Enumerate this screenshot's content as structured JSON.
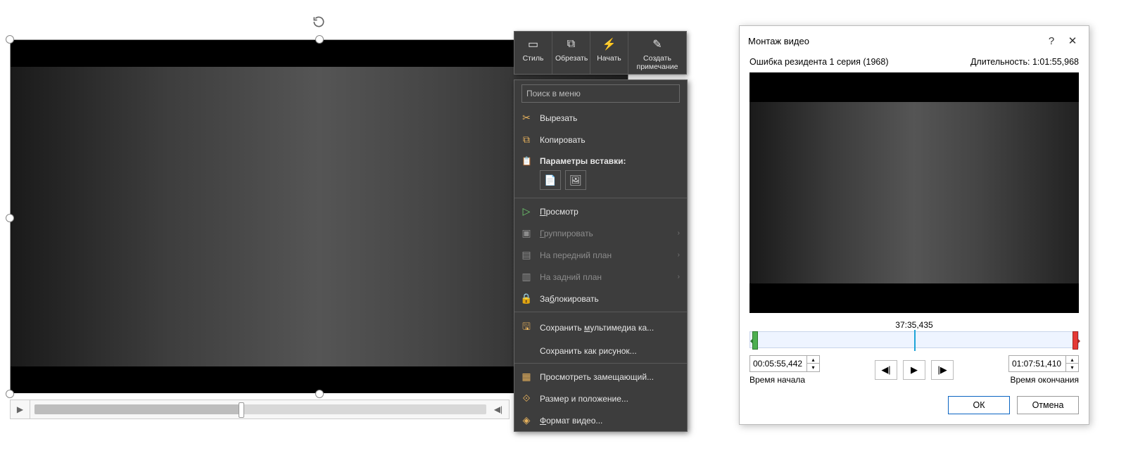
{
  "mini_toolbar": {
    "style": "Стиль",
    "crop": "Обрезать",
    "start": "Начать",
    "note": "Создать примечание"
  },
  "context_menu": {
    "search_placeholder": "Поиск в меню",
    "cut": "Вырезать",
    "copy": "Копировать",
    "paste_heading": "Параметры вставки:",
    "preview": "Просмотр",
    "group": "Группировать",
    "bring_front": "На передний план",
    "send_back": "На задний план",
    "lock": "Заблокировать",
    "save_media": "Сохранить мультимедиа ка...",
    "save_picture": "Сохранить как рисунок...",
    "view_placeholder": "Просмотреть замещающий...",
    "size_position": "Размер и положение...",
    "format_video": "Формат видео..."
  },
  "dialog": {
    "title": "Монтаж видео",
    "video_name": "Ошибка резидента 1 серия (1968)",
    "duration_label": "Длительность:",
    "duration_value": "1:01:55,968",
    "current_time": "37:35,435",
    "start_time": "00:05:55,442",
    "start_label": "Время начала",
    "end_time": "01:07:51,410",
    "end_label": "Время окончания",
    "ok": "ОК",
    "cancel": "Отмена"
  }
}
